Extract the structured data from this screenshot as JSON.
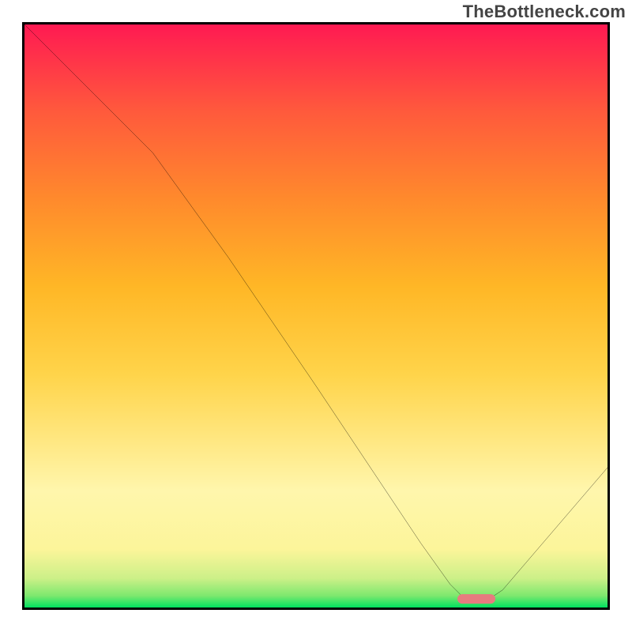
{
  "watermark": "TheBottleneck.com",
  "chart_data": {
    "type": "line",
    "title": "",
    "xlabel": "",
    "ylabel": "",
    "xlim": [
      0,
      100
    ],
    "ylim": [
      0,
      100
    ],
    "grid": false,
    "legend": false,
    "background_gradient": {
      "stops": [
        {
          "pos": 0.0,
          "color": "#00e060"
        },
        {
          "pos": 0.02,
          "color": "#7de86e"
        },
        {
          "pos": 0.05,
          "color": "#ccf088"
        },
        {
          "pos": 0.1,
          "color": "#fcf59a"
        },
        {
          "pos": 0.2,
          "color": "#fff6ac"
        },
        {
          "pos": 0.4,
          "color": "#ffd44a"
        },
        {
          "pos": 0.55,
          "color": "#ffb726"
        },
        {
          "pos": 0.7,
          "color": "#ff8a2c"
        },
        {
          "pos": 0.85,
          "color": "#ff5a3c"
        },
        {
          "pos": 1.0,
          "color": "#ff1a52"
        }
      ]
    },
    "series": [
      {
        "name": "bottleneck-curve",
        "color": "#000000",
        "x": [
          0,
          5,
          12,
          22,
          35,
          50,
          60,
          68,
          73,
          76,
          79,
          82,
          100
        ],
        "y": [
          100,
          95,
          88,
          78,
          60,
          38,
          23,
          11,
          4,
          1,
          1,
          3,
          24
        ]
      }
    ],
    "marker": {
      "name": "optimal-range",
      "color": "#e77b7f",
      "x_center": 77.5,
      "y_center": 1.5,
      "x_width": 6.5,
      "y_height": 1.6
    }
  }
}
